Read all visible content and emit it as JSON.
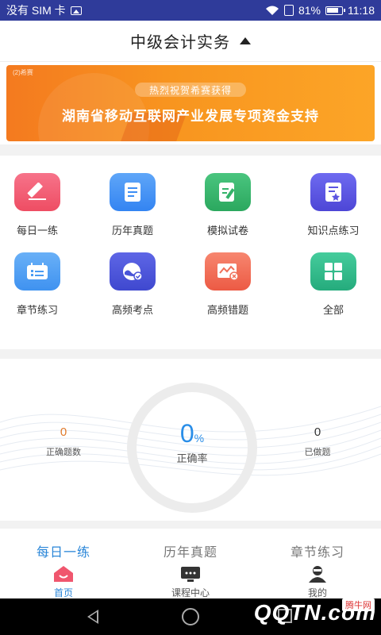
{
  "status_bar": {
    "carrier": "没有 SIM 卡",
    "battery": "81%",
    "time": "11:18"
  },
  "header": {
    "title": "中级会计实务"
  },
  "banner": {
    "tag": "(2)希赛",
    "pill": "热烈祝贺希赛获得",
    "headline": "湖南省移动互联网产业发展专项资金支持"
  },
  "grid": [
    {
      "label": "每日一练",
      "icon": "pencil-icon",
      "color": "#f0566e"
    },
    {
      "label": "历年真题",
      "icon": "document-icon",
      "color": "#3d8ef5"
    },
    {
      "label": "模拟试卷",
      "icon": "edit-document-icon",
      "color": "#34b36a"
    },
    {
      "label": "知识点练习",
      "icon": "star-document-icon",
      "color": "#5b55e0"
    },
    {
      "label": "章节练习",
      "icon": "checklist-icon",
      "color": "#4b9cf3"
    },
    {
      "label": "高频考点",
      "icon": "wave-check-icon",
      "color": "#4a55d8"
    },
    {
      "label": "高频错题",
      "icon": "chart-error-icon",
      "color": "#f06f58"
    },
    {
      "label": "全部",
      "icon": "grid-icon",
      "color": "#30b98a"
    }
  ],
  "stats": {
    "correct_count": "0",
    "correct_count_label": "正确题数",
    "accuracy_value": "0",
    "accuracy_unit": "%",
    "accuracy_label": "正确率",
    "done_count": "0",
    "done_count_label": "已做题"
  },
  "bottom_nav": [
    {
      "tab": "每日一练",
      "label": "首页",
      "icon": "home-icon",
      "active": true
    },
    {
      "tab": "历年真题",
      "label": "课程中心",
      "icon": "course-icon",
      "active": false
    },
    {
      "tab": "章节练习",
      "label": "我的",
      "icon": "user-icon",
      "active": false
    }
  ],
  "watermark": {
    "text": "QQTN.com",
    "tag": "腾牛网"
  },
  "colors": {
    "status_bar": "#2f3b9a",
    "accent": "#2a86d8",
    "banner": "#f8951f"
  }
}
